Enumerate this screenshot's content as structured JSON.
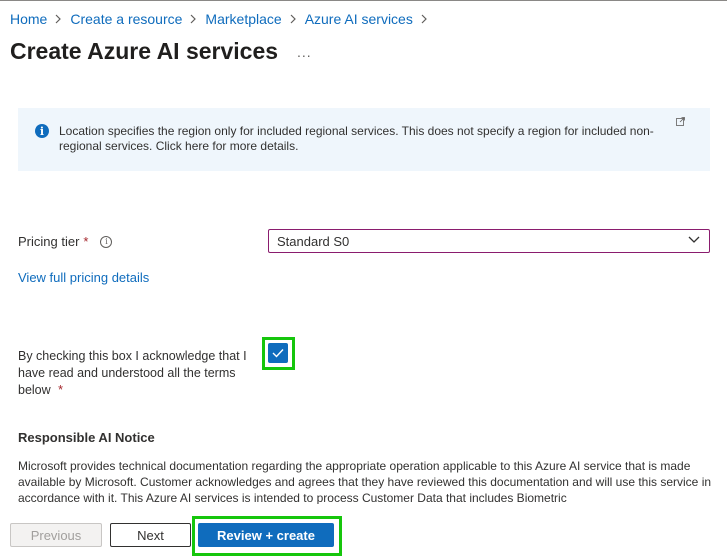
{
  "breadcrumb": {
    "items": [
      "Home",
      "Create a resource",
      "Marketplace",
      "Azure AI services"
    ]
  },
  "page": {
    "title": "Create Azure AI services",
    "more_label": "..."
  },
  "info_box": {
    "text": "Location specifies the region only for included regional services. This does not specify a region for included non-regional services. Click here for more details."
  },
  "pricing": {
    "label": "Pricing tier",
    "required": "*",
    "selected_value": "Standard S0",
    "details_link": "View full pricing details"
  },
  "acknowledge": {
    "text": "By checking this box I acknowledge that I have read and understood all the terms below",
    "required": "*",
    "checked": true
  },
  "notice": {
    "title": "Responsible AI Notice",
    "body": "Microsoft provides technical documentation regarding the appropriate operation applicable to this Azure AI service that is made available by Microsoft. Customer acknowledges and agrees that they have reviewed this documentation and will use this service in accordance with it. This Azure AI services is intended to process Customer Data that includes Biometric"
  },
  "footer": {
    "previous_label": "Previous",
    "next_label": "Next",
    "review_label": "Review + create"
  },
  "colors": {
    "accent": "#0f6cbd",
    "highlight": "#16c60c",
    "required": "#a4262c",
    "info_background": "#eff6fc"
  },
  "icons": [
    "chevron-right-icon",
    "more-icon",
    "info-icon",
    "external-link-icon",
    "tooltip-info-icon",
    "chevron-down-icon",
    "checkmark-icon"
  ]
}
